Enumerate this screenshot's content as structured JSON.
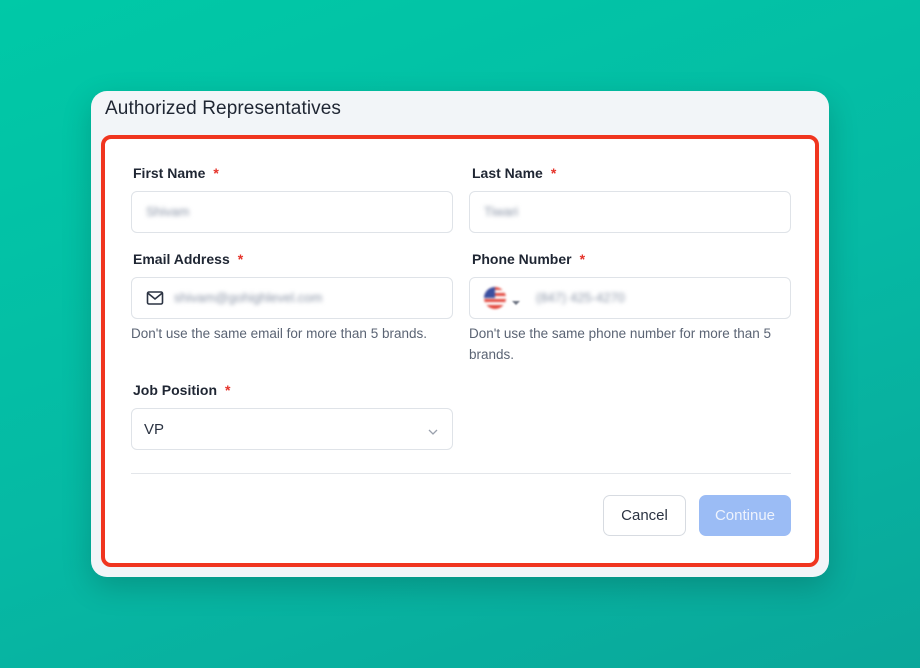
{
  "dialog": {
    "title": "Authorized Representatives"
  },
  "form": {
    "first_name": {
      "label": "First Name",
      "required_mark": "*",
      "value": "Shivam"
    },
    "last_name": {
      "label": "Last Name",
      "required_mark": "*",
      "value": "Tiwari"
    },
    "email": {
      "label": "Email Address",
      "required_mark": "*",
      "value": "shivam@gohighlevel.com",
      "hint": "Don't use the same email for more than 5 brands.",
      "icon": "mail-icon"
    },
    "phone": {
      "label": "Phone Number",
      "required_mark": "*",
      "value": "(847) 425-4270",
      "country_icon": "us-flag-icon",
      "hint": "Don't use the same phone number for more than 5 brands."
    },
    "job_position": {
      "label": "Job Position",
      "required_mark": "*",
      "selected": "VP"
    }
  },
  "actions": {
    "cancel_label": "Cancel",
    "continue_label": "Continue"
  },
  "colors": {
    "highlight_border": "#f0351f",
    "required": "#e5332a",
    "continue_disabled": "#9bbcf5",
    "background_gradient_start": "#00c9a7",
    "background_gradient_end": "#0aa79a"
  }
}
